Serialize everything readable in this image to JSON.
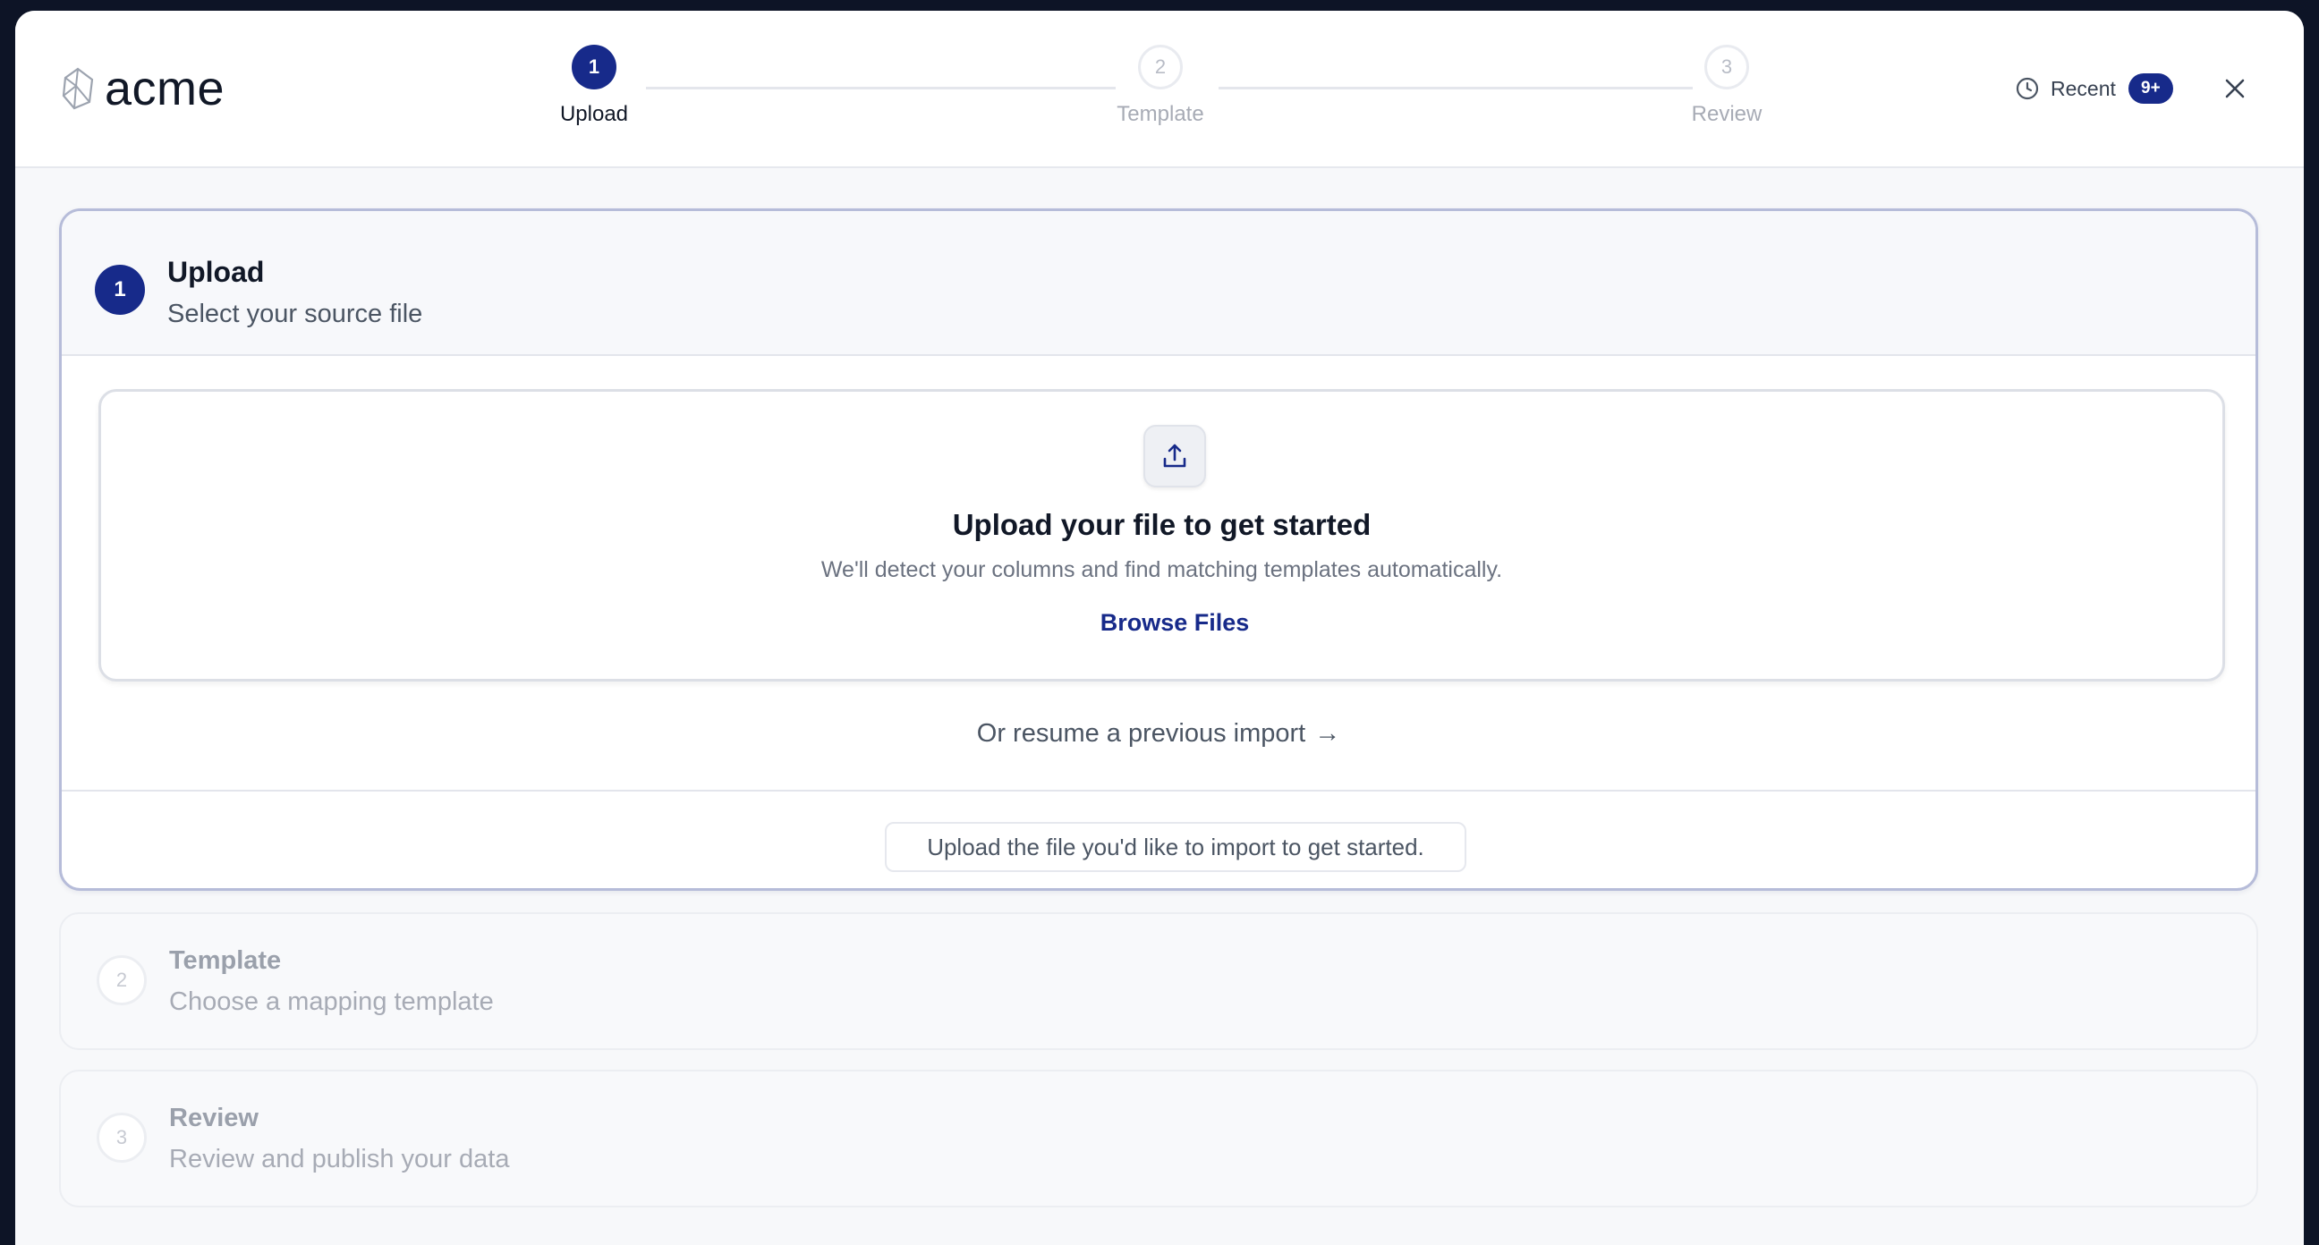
{
  "brand": {
    "name": "acme"
  },
  "stepper": [
    {
      "num": "1",
      "label": "Upload",
      "state": "active"
    },
    {
      "num": "2",
      "label": "Template",
      "state": "inactive"
    },
    {
      "num": "3",
      "label": "Review",
      "state": "inactive"
    }
  ],
  "recent": {
    "label": "Recent",
    "badge": "9+",
    "icon": "clock-icon"
  },
  "close": {
    "icon": "close-icon"
  },
  "upload_step": {
    "num": "1",
    "title": "Upload",
    "subtitle": "Select your source file",
    "dropzone": {
      "icon": "upload-icon",
      "title": "Upload your file to get started",
      "subtitle": "We'll detect your columns and find matching templates automatically.",
      "browse_label": "Browse Files"
    },
    "resume_label": "Or resume a previous import",
    "resume_arrow": "→",
    "hint": "Upload the file you'd like to import to get started."
  },
  "template_step": {
    "num": "2",
    "title": "Template",
    "subtitle": "Choose a mapping template"
  },
  "review_step": {
    "num": "3",
    "title": "Review",
    "subtitle": "Review and publish your data"
  },
  "colors": {
    "accent": "#172a8a",
    "border_active": "#b6bcd9",
    "muted": "#a7abb5"
  }
}
